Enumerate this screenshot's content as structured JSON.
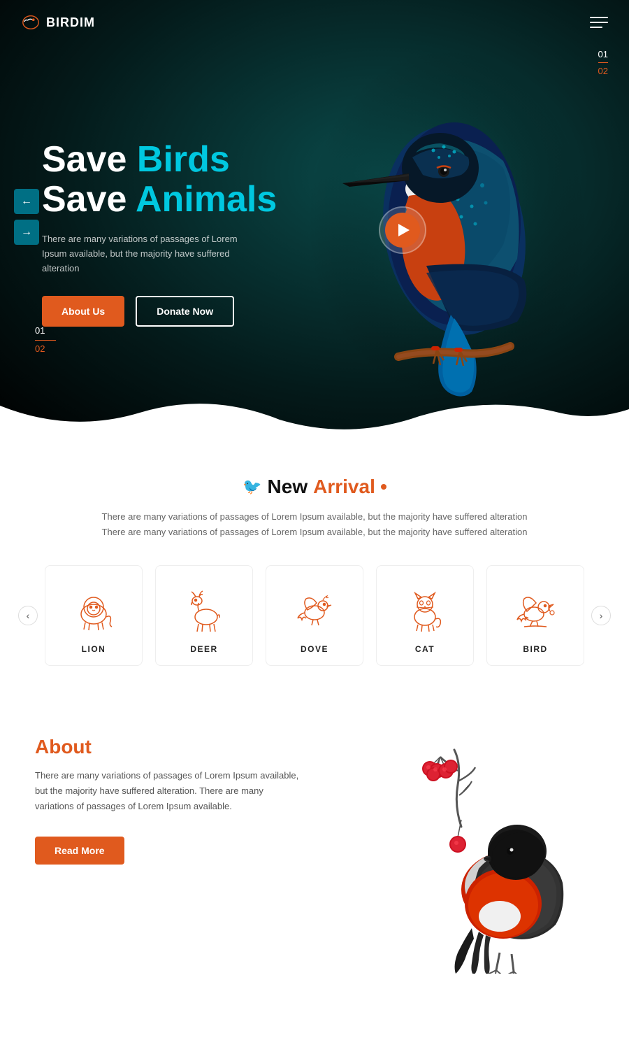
{
  "brand": {
    "name": "BIRDIM"
  },
  "header": {
    "logo_text": "BIRDIM"
  },
  "hero": {
    "slide_current_top": "01",
    "slide_total_top": "02",
    "title_line1_plain": "Save ",
    "title_line1_accent": "Birds",
    "title_line2_plain": "Save ",
    "title_line2_accent": "Animals",
    "subtitle": "There are many variations of passages of Lorem Ipsum available, but the majority have suffered alteration",
    "btn_about": "About Us",
    "btn_donate": "Donate Now",
    "slide_current_bottom": "01",
    "slide_total_bottom": "02"
  },
  "new_arrival": {
    "section_icon": "🐦",
    "title_plain": "New ",
    "title_accent": "Arrival",
    "description": "There are many variations of passages of Lorem Ipsum available, but the majority have suffered alteration There are many variations of passages of Lorem Ipsum available, but the majority have suffered alteration",
    "animals": [
      {
        "name": "LION",
        "icon": "lion"
      },
      {
        "name": "DEER",
        "icon": "deer"
      },
      {
        "name": "DOVE",
        "icon": "dove"
      },
      {
        "name": "CAT",
        "icon": "cat"
      },
      {
        "name": "BIRD",
        "icon": "bird"
      }
    ]
  },
  "about": {
    "label": "About",
    "description": "There are many variations of passages of Lorem Ipsum available, but the majority have suffered alteration. There are many variations of passages of Lorem Ipsum available.",
    "read_more": "Read More"
  }
}
